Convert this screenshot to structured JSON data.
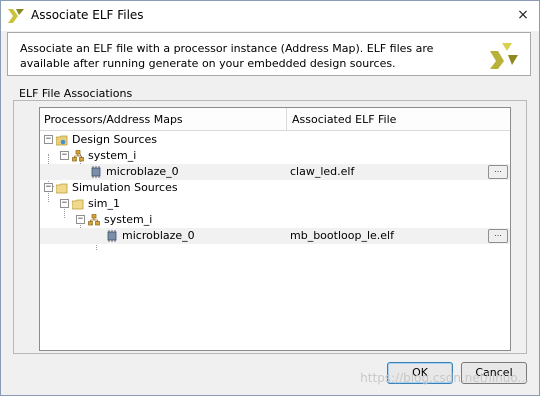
{
  "window": {
    "title": "Associate ELF Files",
    "close_icon": "×"
  },
  "description": "Associate an ELF file with a processor instance (Address Map). ELF files are available after running generate on your embedded design sources.",
  "group_label": "ELF File Associations",
  "table": {
    "columns": [
      "Processors/Address Maps",
      "Associated ELF File"
    ],
    "rows": [
      {
        "label": "Design Sources",
        "icon": "sources-folder-icon",
        "elf": ""
      },
      {
        "label": "system_i",
        "icon": "hierarchy-icon",
        "elf": ""
      },
      {
        "label": "microblaze_0",
        "icon": "processor-icon",
        "elf": "claw_led.elf",
        "browse": "..."
      },
      {
        "label": "Simulation Sources",
        "icon": "folder-icon",
        "elf": ""
      },
      {
        "label": "sim_1",
        "icon": "folder-icon",
        "elf": ""
      },
      {
        "label": "system_i",
        "icon": "hierarchy-icon",
        "elf": ""
      },
      {
        "label": "microblaze_0",
        "icon": "processor-icon",
        "elf": "mb_bootloop_le.elf",
        "browse": "..."
      }
    ]
  },
  "buttons": {
    "ok": "OK",
    "cancel": "Cancel"
  },
  "watermark": "https://blog.csdn.net/lihuo..."
}
